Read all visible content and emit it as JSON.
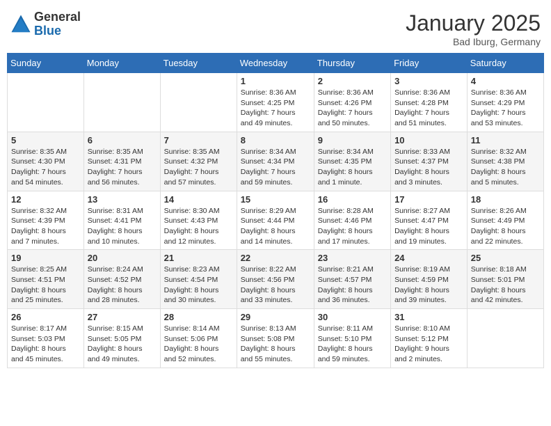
{
  "header": {
    "logo_general": "General",
    "logo_blue": "Blue",
    "month_title": "January 2025",
    "location": "Bad Iburg, Germany"
  },
  "weekdays": [
    "Sunday",
    "Monday",
    "Tuesday",
    "Wednesday",
    "Thursday",
    "Friday",
    "Saturday"
  ],
  "weeks": [
    [
      {
        "day": "",
        "info": ""
      },
      {
        "day": "",
        "info": ""
      },
      {
        "day": "",
        "info": ""
      },
      {
        "day": "1",
        "info": "Sunrise: 8:36 AM\nSunset: 4:25 PM\nDaylight: 7 hours\nand 49 minutes."
      },
      {
        "day": "2",
        "info": "Sunrise: 8:36 AM\nSunset: 4:26 PM\nDaylight: 7 hours\nand 50 minutes."
      },
      {
        "day": "3",
        "info": "Sunrise: 8:36 AM\nSunset: 4:28 PM\nDaylight: 7 hours\nand 51 minutes."
      },
      {
        "day": "4",
        "info": "Sunrise: 8:36 AM\nSunset: 4:29 PM\nDaylight: 7 hours\nand 53 minutes."
      }
    ],
    [
      {
        "day": "5",
        "info": "Sunrise: 8:35 AM\nSunset: 4:30 PM\nDaylight: 7 hours\nand 54 minutes."
      },
      {
        "day": "6",
        "info": "Sunrise: 8:35 AM\nSunset: 4:31 PM\nDaylight: 7 hours\nand 56 minutes."
      },
      {
        "day": "7",
        "info": "Sunrise: 8:35 AM\nSunset: 4:32 PM\nDaylight: 7 hours\nand 57 minutes."
      },
      {
        "day": "8",
        "info": "Sunrise: 8:34 AM\nSunset: 4:34 PM\nDaylight: 7 hours\nand 59 minutes."
      },
      {
        "day": "9",
        "info": "Sunrise: 8:34 AM\nSunset: 4:35 PM\nDaylight: 8 hours\nand 1 minute."
      },
      {
        "day": "10",
        "info": "Sunrise: 8:33 AM\nSunset: 4:37 PM\nDaylight: 8 hours\nand 3 minutes."
      },
      {
        "day": "11",
        "info": "Sunrise: 8:32 AM\nSunset: 4:38 PM\nDaylight: 8 hours\nand 5 minutes."
      }
    ],
    [
      {
        "day": "12",
        "info": "Sunrise: 8:32 AM\nSunset: 4:39 PM\nDaylight: 8 hours\nand 7 minutes."
      },
      {
        "day": "13",
        "info": "Sunrise: 8:31 AM\nSunset: 4:41 PM\nDaylight: 8 hours\nand 10 minutes."
      },
      {
        "day": "14",
        "info": "Sunrise: 8:30 AM\nSunset: 4:43 PM\nDaylight: 8 hours\nand 12 minutes."
      },
      {
        "day": "15",
        "info": "Sunrise: 8:29 AM\nSunset: 4:44 PM\nDaylight: 8 hours\nand 14 minutes."
      },
      {
        "day": "16",
        "info": "Sunrise: 8:28 AM\nSunset: 4:46 PM\nDaylight: 8 hours\nand 17 minutes."
      },
      {
        "day": "17",
        "info": "Sunrise: 8:27 AM\nSunset: 4:47 PM\nDaylight: 8 hours\nand 19 minutes."
      },
      {
        "day": "18",
        "info": "Sunrise: 8:26 AM\nSunset: 4:49 PM\nDaylight: 8 hours\nand 22 minutes."
      }
    ],
    [
      {
        "day": "19",
        "info": "Sunrise: 8:25 AM\nSunset: 4:51 PM\nDaylight: 8 hours\nand 25 minutes."
      },
      {
        "day": "20",
        "info": "Sunrise: 8:24 AM\nSunset: 4:52 PM\nDaylight: 8 hours\nand 28 minutes."
      },
      {
        "day": "21",
        "info": "Sunrise: 8:23 AM\nSunset: 4:54 PM\nDaylight: 8 hours\nand 30 minutes."
      },
      {
        "day": "22",
        "info": "Sunrise: 8:22 AM\nSunset: 4:56 PM\nDaylight: 8 hours\nand 33 minutes."
      },
      {
        "day": "23",
        "info": "Sunrise: 8:21 AM\nSunset: 4:57 PM\nDaylight: 8 hours\nand 36 minutes."
      },
      {
        "day": "24",
        "info": "Sunrise: 8:19 AM\nSunset: 4:59 PM\nDaylight: 8 hours\nand 39 minutes."
      },
      {
        "day": "25",
        "info": "Sunrise: 8:18 AM\nSunset: 5:01 PM\nDaylight: 8 hours\nand 42 minutes."
      }
    ],
    [
      {
        "day": "26",
        "info": "Sunrise: 8:17 AM\nSunset: 5:03 PM\nDaylight: 8 hours\nand 45 minutes."
      },
      {
        "day": "27",
        "info": "Sunrise: 8:15 AM\nSunset: 5:05 PM\nDaylight: 8 hours\nand 49 minutes."
      },
      {
        "day": "28",
        "info": "Sunrise: 8:14 AM\nSunset: 5:06 PM\nDaylight: 8 hours\nand 52 minutes."
      },
      {
        "day": "29",
        "info": "Sunrise: 8:13 AM\nSunset: 5:08 PM\nDaylight: 8 hours\nand 55 minutes."
      },
      {
        "day": "30",
        "info": "Sunrise: 8:11 AM\nSunset: 5:10 PM\nDaylight: 8 hours\nand 59 minutes."
      },
      {
        "day": "31",
        "info": "Sunrise: 8:10 AM\nSunset: 5:12 PM\nDaylight: 9 hours\nand 2 minutes."
      },
      {
        "day": "",
        "info": ""
      }
    ]
  ]
}
